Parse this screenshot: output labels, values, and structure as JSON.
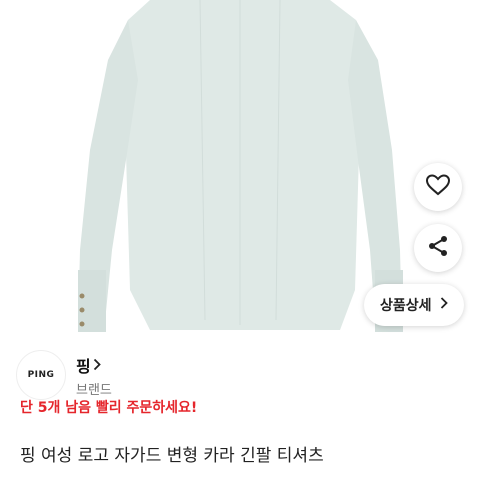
{
  "product": {
    "brand_logo_text": "PING",
    "brand_name": "핑",
    "brand_caption": "브랜드",
    "stock_warning": "단 5개 남음 빨리 주문하세요!",
    "title": "핑 여성 로고 자가드 변형 카라 긴팔 티셔츠"
  },
  "actions": {
    "detail_label": "상품상세"
  },
  "icons": {
    "like": "heart-icon",
    "share": "share-icon",
    "detail_arrow": "chevron-right-icon",
    "brand_arrow": "chevron-right-icon"
  },
  "colors": {
    "garment": "#dfe9e6",
    "warning": "#e5262c"
  }
}
